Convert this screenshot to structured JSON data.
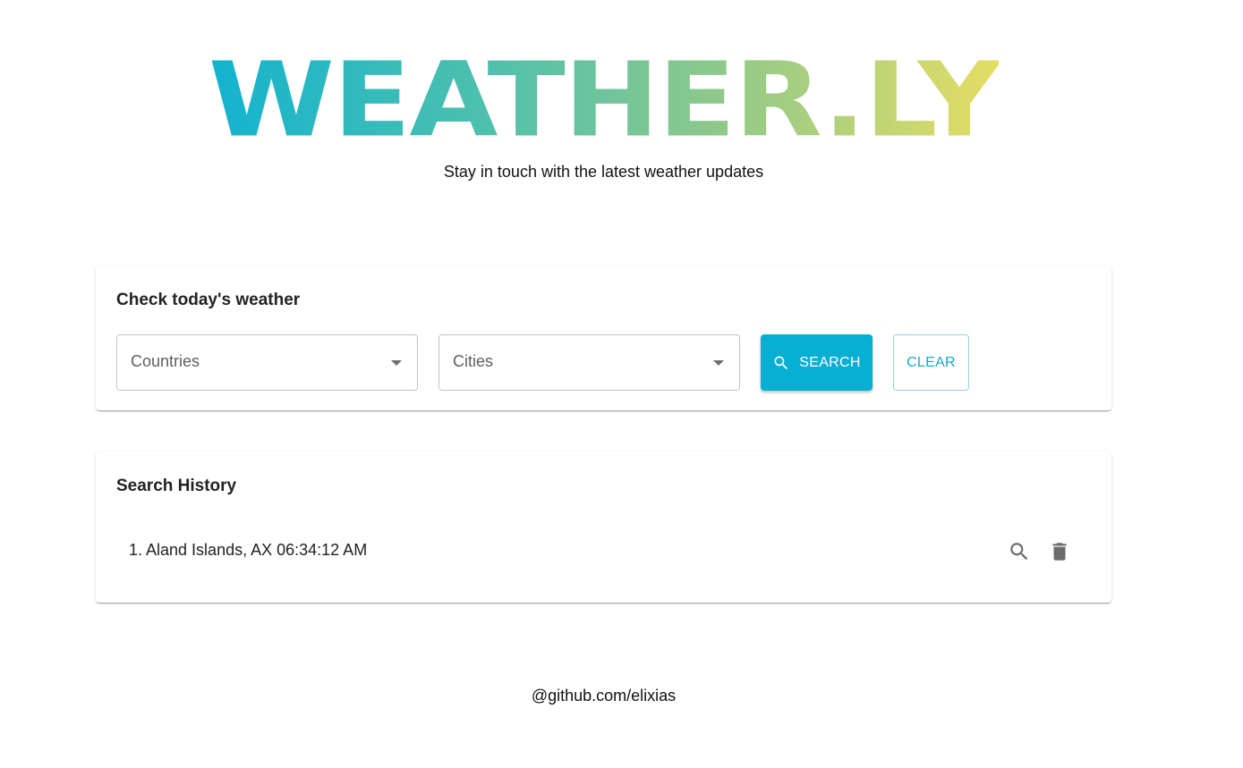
{
  "header": {
    "logo_text": "WEATHER.LY",
    "tagline": "Stay in touch with the latest weather updates"
  },
  "weather_card": {
    "title": "Check today's weather",
    "country_select": {
      "placeholder": "Countries"
    },
    "city_select": {
      "placeholder": "Cities"
    },
    "search_button": {
      "label": "SEARCH",
      "icon": "search-icon"
    },
    "clear_button": {
      "label": "CLEAR"
    }
  },
  "history_card": {
    "title": "Search History",
    "items": [
      {
        "text": "1. Aland Islands, AX 06:34:12 AM",
        "actions": [
          "search-icon",
          "trash-icon"
        ]
      }
    ]
  },
  "footer": {
    "text": "@github.com/elixias"
  },
  "colors": {
    "primary": "#07afd3",
    "logo_gradient": [
      "#12b3cf",
      "#4ec0ad",
      "#8fc98a",
      "#e5dd64"
    ],
    "icon_gray": "#6b6b6b"
  }
}
